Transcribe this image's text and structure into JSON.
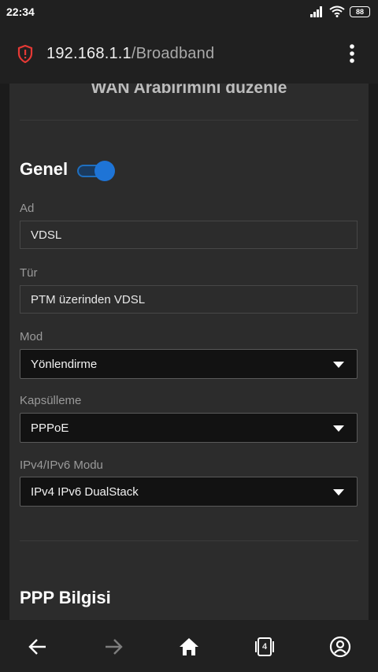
{
  "status_bar": {
    "time": "22:34",
    "battery": "88",
    "icons": [
      "signal-icon",
      "wifi-icon",
      "battery-icon"
    ]
  },
  "browser": {
    "url_host": "192.168.1.1",
    "url_path": "/Broadband",
    "security_icon": "warning-shield-icon",
    "menu_icon": "more-vert-icon"
  },
  "page": {
    "title": "WAN Arabirimini düzenle",
    "general": {
      "heading": "Genel",
      "enabled": true
    },
    "fields": {
      "ad": {
        "label": "Ad",
        "value": "VDSL"
      },
      "tur": {
        "label": "Tür",
        "value": "PTM üzerinden VDSL"
      },
      "mod": {
        "label": "Mod",
        "value": "Yönlendirme"
      },
      "kapsulleme": {
        "label": "Kapsülleme",
        "value": "PPPoE"
      },
      "ip_mode": {
        "label": "IPv4/IPv6 Modu",
        "value": "IPv4 IPv6 DualStack"
      }
    },
    "ppp_heading": "PPP Bilgisi"
  },
  "nav": {
    "tab_count": "4",
    "icons": [
      "back-arrow-icon",
      "forward-arrow-icon",
      "home-icon",
      "tabs-icon",
      "account-icon"
    ]
  },
  "colors": {
    "accent": "#1e74d6",
    "card_bg": "#2c2c2c",
    "warning": "#e53935"
  }
}
